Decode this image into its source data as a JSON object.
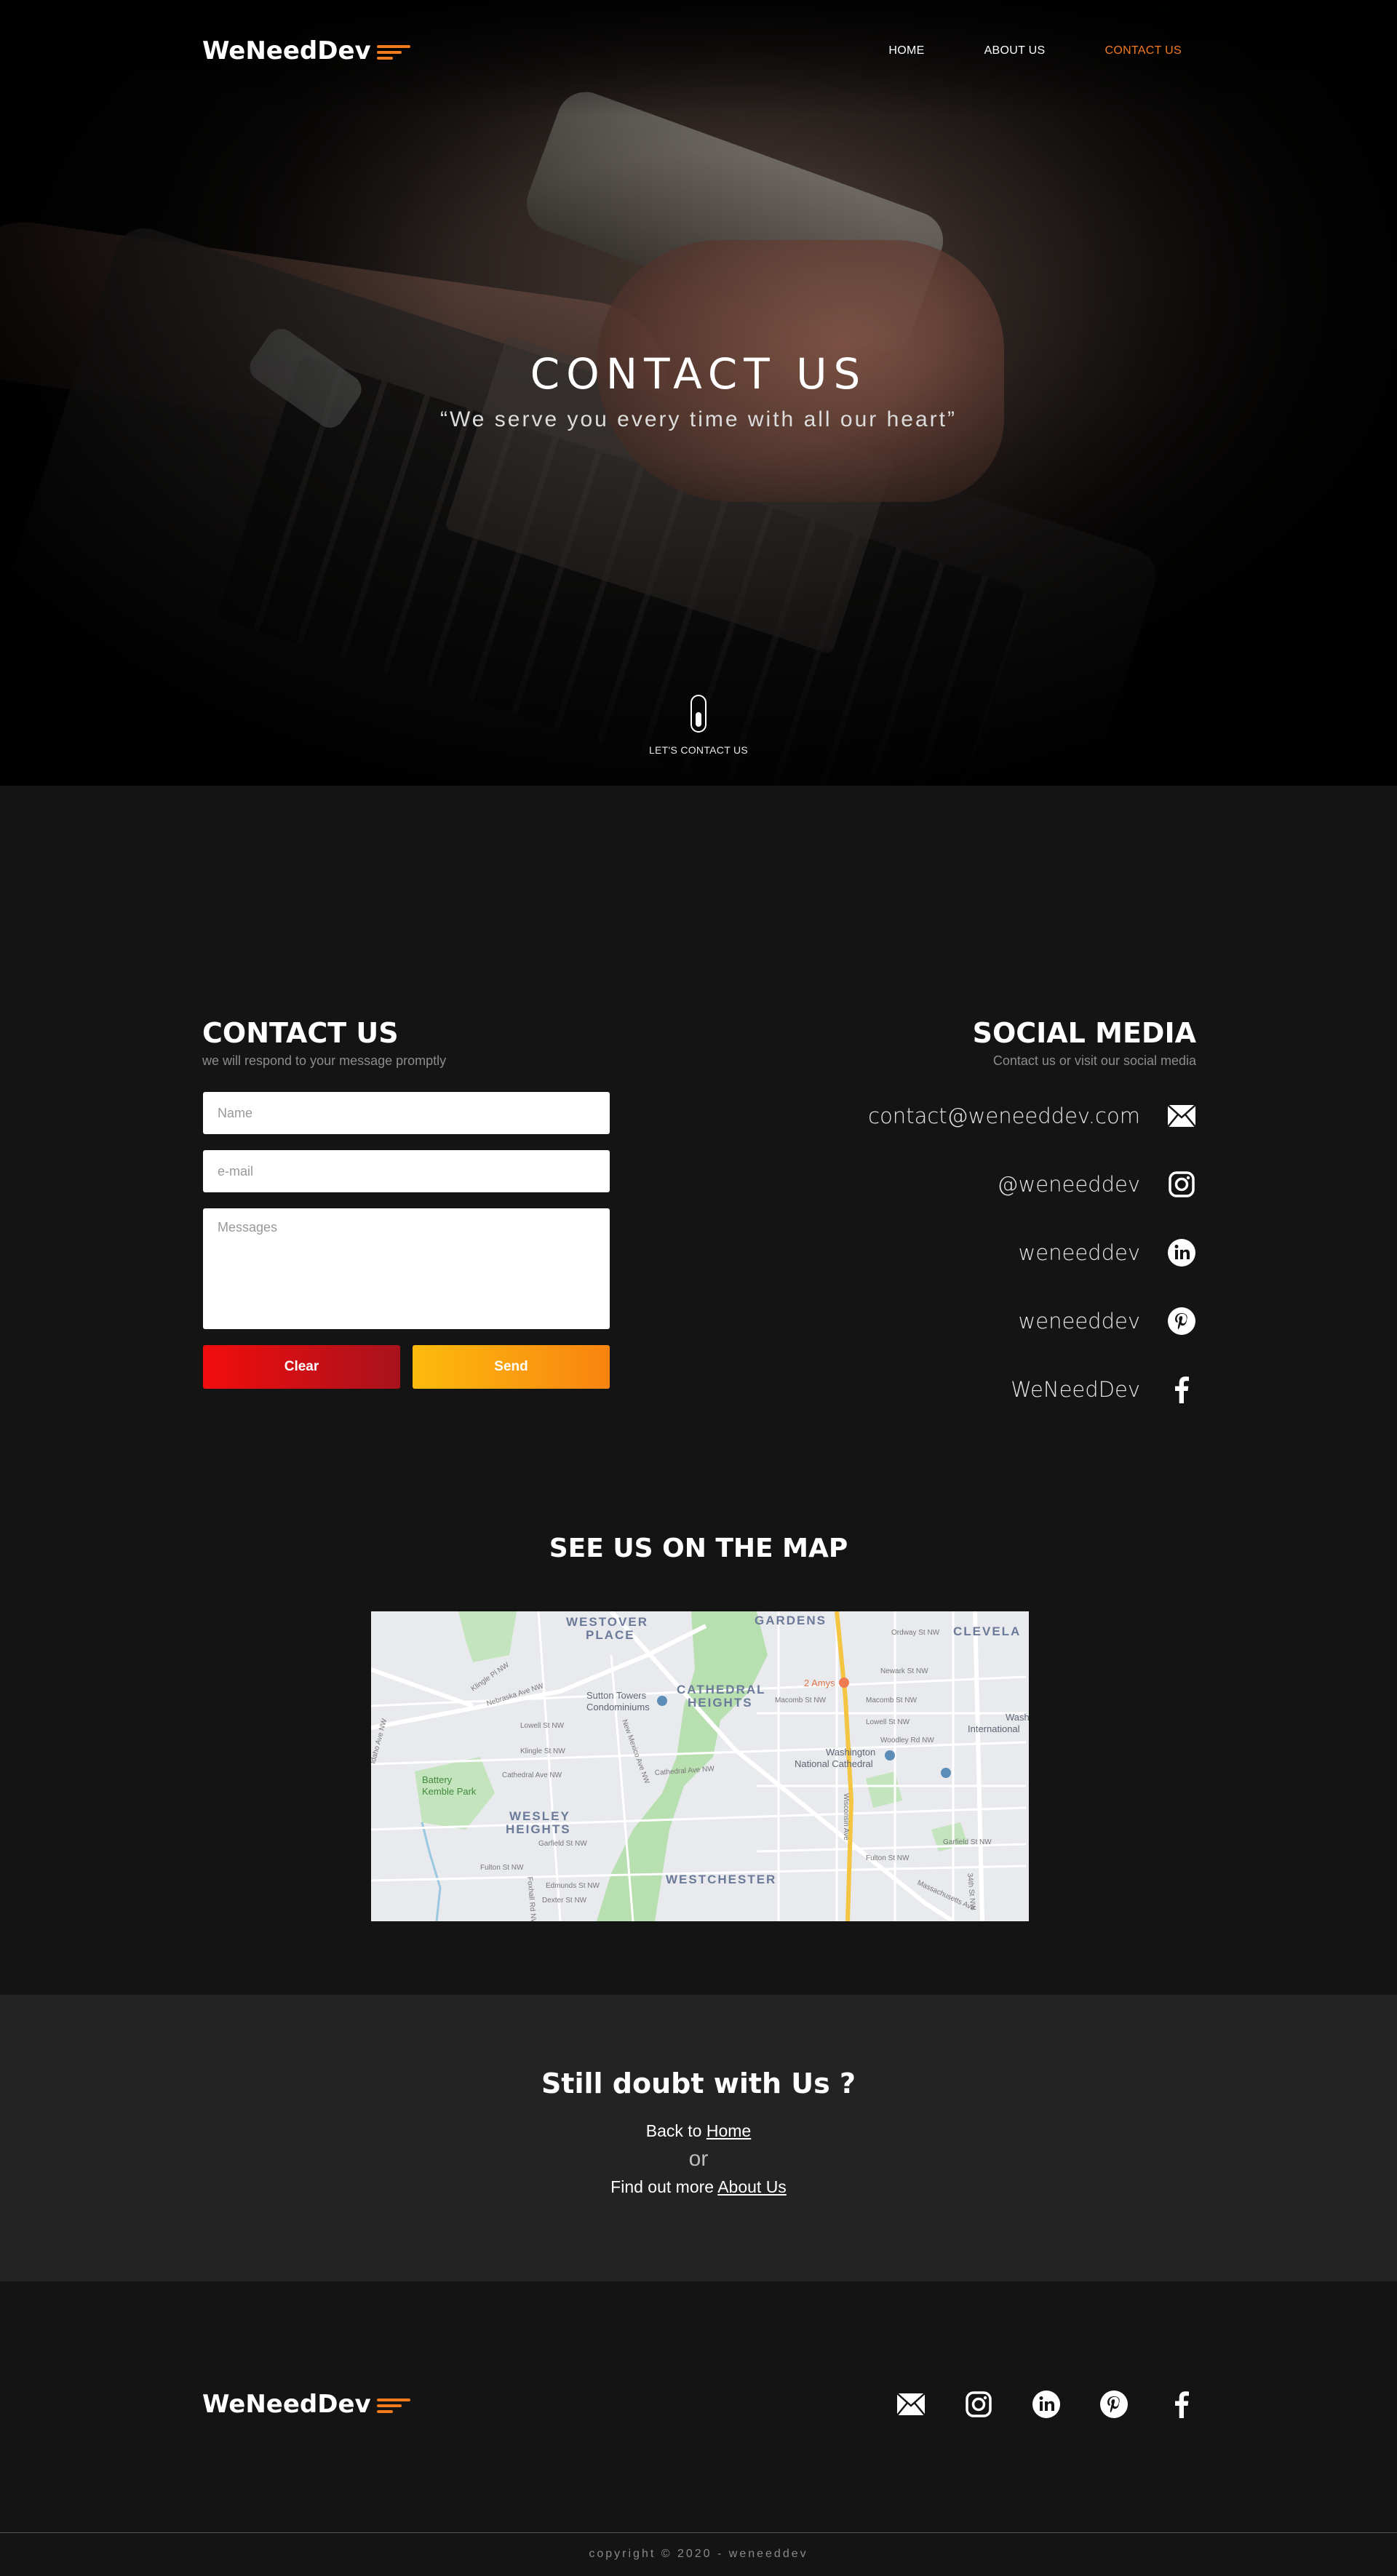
{
  "brand": {
    "name": "WeNeedDev",
    "accent": "#f47a20"
  },
  "nav": {
    "items": [
      {
        "label": "HOME"
      },
      {
        "label": "ABOUT US"
      },
      {
        "label": "CONTACT US"
      }
    ],
    "active": "CONTACT US"
  },
  "hero": {
    "title": "CONTACT US",
    "quote": "“We serve you every time with all our heart”",
    "scroll_label": "LET'S CONTACT US"
  },
  "contact": {
    "title": "CONTACT US",
    "subtitle": "we will respond to your message promptly",
    "form": {
      "name_placeholder": "Name",
      "email_placeholder": "e-mail",
      "message_placeholder": "Messages",
      "clear_label": "Clear",
      "send_label": "Send"
    }
  },
  "social": {
    "title": "SOCIAL MEDIA",
    "subtitle": "Contact us or visit our social media",
    "items": [
      {
        "label": "contact@weneeddev.com",
        "icon": "envelope-icon"
      },
      {
        "label": "@weneeddev",
        "icon": "instagram-icon"
      },
      {
        "label": "weneeddev",
        "icon": "linkedin-icon"
      },
      {
        "label": "weneeddev",
        "icon": "pinterest-icon"
      },
      {
        "label": "WeNeedDev",
        "icon": "facebook-icon"
      }
    ]
  },
  "map": {
    "title": "SEE US ON THE MAP",
    "labels": {
      "westover": "WESTOVER",
      "place": "PLACE",
      "gardens": "GARDENS",
      "clevela": "CLEVELA",
      "cathedral": "CATHEDRAL",
      "heights": "HEIGHTS",
      "sutton1": "Sutton Towers",
      "sutton2": "Condominiums",
      "amys": "2 Amys",
      "washington1": "Washington",
      "washington2": "National Cathedral",
      "wesley": "WESLEY",
      "wesley_heights": "HEIGHTS",
      "battery1": "Battery",
      "battery2": "Kemble Park",
      "westchester": "WESTCHESTER",
      "wash_intl1": "Wash",
      "wash_intl2": "International",
      "wisconsin": "Wisconsin Ave",
      "nebraska": "Nebraska Ave NW",
      "new_mexico": "New Mexico Ave NW",
      "cathedral_ave": "Cathedral Ave NW",
      "macomb": "Macomb St NW",
      "lowell": "Lowell St NW",
      "klingle": "Klingle St NW",
      "woodley": "Woodley Rd NW",
      "garfield": "Garfield St NW",
      "fulton": "Fulton St NW",
      "newark": "Newark St NW",
      "ordway": "Ordway St NW",
      "massachusetts": "Massachusetts Ave",
      "foxhall": "Foxhall Rd NW",
      "thirty_fourth": "34th St NW",
      "dexter": "Dexter St NW",
      "edmunds": "Edmunds St NW",
      "klingle_pl": "Klingle Pl NW",
      "idaho": "Idaho Ave NW"
    }
  },
  "doubt": {
    "title": "Still doubt with Us ?",
    "back_prefix": "Back to",
    "back_link": "Home",
    "or": "or",
    "more_prefix": "Find out more",
    "more_link": "About Us"
  },
  "footer": {
    "copyright": "copyright © 2020 - weneeddev"
  }
}
